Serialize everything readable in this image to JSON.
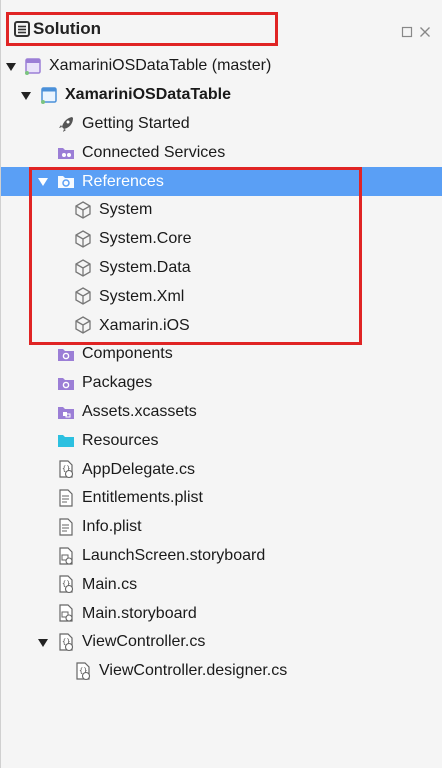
{
  "header": {
    "title": "Solution"
  },
  "tree": [
    {
      "label": "XamariniOSDataTable (master)",
      "icon": "solution-icon",
      "expanded": true,
      "depth": 0
    },
    {
      "label": "XamariniOSDataTable",
      "icon": "project-icon",
      "expanded": true,
      "depth": 1,
      "bold": true
    },
    {
      "label": "Getting Started",
      "icon": "rocket-icon",
      "depth": 2
    },
    {
      "label": "Connected Services",
      "icon": "connected-services-icon",
      "depth": 2
    },
    {
      "label": "References",
      "icon": "references-folder-icon",
      "expanded": true,
      "depth": 2,
      "selected": true
    },
    {
      "label": "System",
      "icon": "assembly-icon",
      "depth": 3
    },
    {
      "label": "System.Core",
      "icon": "assembly-icon",
      "depth": 3
    },
    {
      "label": "System.Data",
      "icon": "assembly-icon",
      "depth": 3
    },
    {
      "label": "System.Xml",
      "icon": "assembly-icon",
      "depth": 3
    },
    {
      "label": "Xamarin.iOS",
      "icon": "assembly-icon",
      "depth": 3
    },
    {
      "label": "Components",
      "icon": "special-folder-icon",
      "depth": 2
    },
    {
      "label": "Packages",
      "icon": "special-folder-icon",
      "depth": 2
    },
    {
      "label": "Assets.xcassets",
      "icon": "assets-icon",
      "depth": 2
    },
    {
      "label": "Resources",
      "icon": "folder-icon",
      "depth": 2
    },
    {
      "label": "AppDelegate.cs",
      "icon": "cs-file-icon",
      "depth": 2
    },
    {
      "label": "Entitlements.plist",
      "icon": "plist-file-icon",
      "depth": 2
    },
    {
      "label": "Info.plist",
      "icon": "plist-file-icon",
      "depth": 2
    },
    {
      "label": "LaunchScreen.storyboard",
      "icon": "storyboard-file-icon",
      "depth": 2
    },
    {
      "label": "Main.cs",
      "icon": "cs-file-icon",
      "depth": 2
    },
    {
      "label": "Main.storyboard",
      "icon": "storyboard-file-icon",
      "depth": 2
    },
    {
      "label": "ViewController.cs",
      "icon": "cs-file-icon",
      "expanded": true,
      "depth": 2
    },
    {
      "label": "ViewController.designer.cs",
      "icon": "cs-file-icon",
      "depth": 3
    }
  ],
  "colors": {
    "selection": "#5a9ff5",
    "highlight_box": "#e02424",
    "purple_icon": "#9b7ed6",
    "cyan_folder": "#2cc0e0"
  }
}
